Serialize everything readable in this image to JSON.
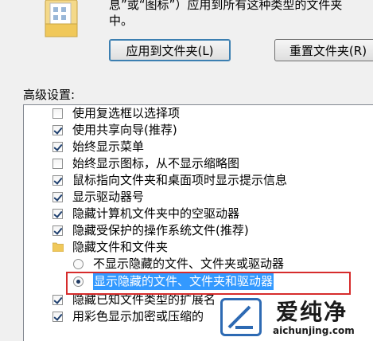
{
  "top": {
    "description": "息”或“图标”）应用到所有这种类型的文件夹\n中。",
    "apply_button": "应用到文件夹(L)",
    "reset_button": "重置文件夹(R)"
  },
  "advanced": {
    "section_label": "高级设置:",
    "items": [
      {
        "label": "使用复选框以选择项",
        "type": "checkbox",
        "checked": false
      },
      {
        "label": "使用共享向导(推荐)",
        "type": "checkbox",
        "checked": true
      },
      {
        "label": "始终显示菜单",
        "type": "checkbox",
        "checked": true
      },
      {
        "label": "始终显示图标，从不显示缩略图",
        "type": "checkbox",
        "checked": false
      },
      {
        "label": "鼠标指向文件夹和桌面项时显示提示信息",
        "type": "checkbox",
        "checked": true
      },
      {
        "label": "显示驱动器号",
        "type": "checkbox",
        "checked": true
      },
      {
        "label": "隐藏计算机文件夹中的空驱动器",
        "type": "checkbox",
        "checked": true
      },
      {
        "label": "隐藏受保护的操作系统文件(推荐)",
        "type": "checkbox",
        "checked": true
      },
      {
        "label": "隐藏文件和文件夹",
        "type": "folder"
      },
      {
        "label": "不显示隐藏的文件、文件夹或驱动器",
        "type": "radio",
        "checked": false
      },
      {
        "label": "显示隐藏的文件、文件夹和驱动器",
        "type": "radio",
        "checked": true
      },
      {
        "label": "隐藏已知文件类型的扩展名",
        "type": "checkbox",
        "checked": true
      },
      {
        "label": "用彩色显示加密或压缩的",
        "type": "checkbox",
        "checked": true
      }
    ]
  },
  "watermark": {
    "name": "爱纯净",
    "url": "aichunjing.com"
  },
  "colors": {
    "selection": "#3399ff",
    "highlight_border": "#d62c2c",
    "watermark_blue": "#2d6ab3"
  }
}
